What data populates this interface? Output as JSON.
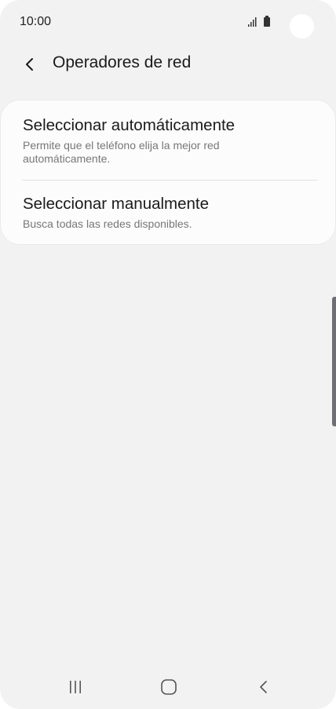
{
  "status_bar": {
    "time": "10:00",
    "icons": [
      "signal-icon",
      "battery-icon"
    ]
  },
  "header": {
    "back_icon": "chevron-left-icon",
    "title": "Operadores de red"
  },
  "options": [
    {
      "title": "Seleccionar automáticamente",
      "description": "Permite que el teléfono elija la mejor red automáticamente."
    },
    {
      "title": "Seleccionar manualmente",
      "description": "Busca todas las redes disponibles."
    }
  ],
  "nav_bar": {
    "icons": [
      "recent-apps-icon",
      "home-icon",
      "back-icon"
    ]
  },
  "colors": {
    "background": "#f2f2f2",
    "card": "#fcfcfc",
    "title_text": "#1a1a1a",
    "secondary_text": "#777777",
    "scroll_handle": "#6e6e75"
  }
}
